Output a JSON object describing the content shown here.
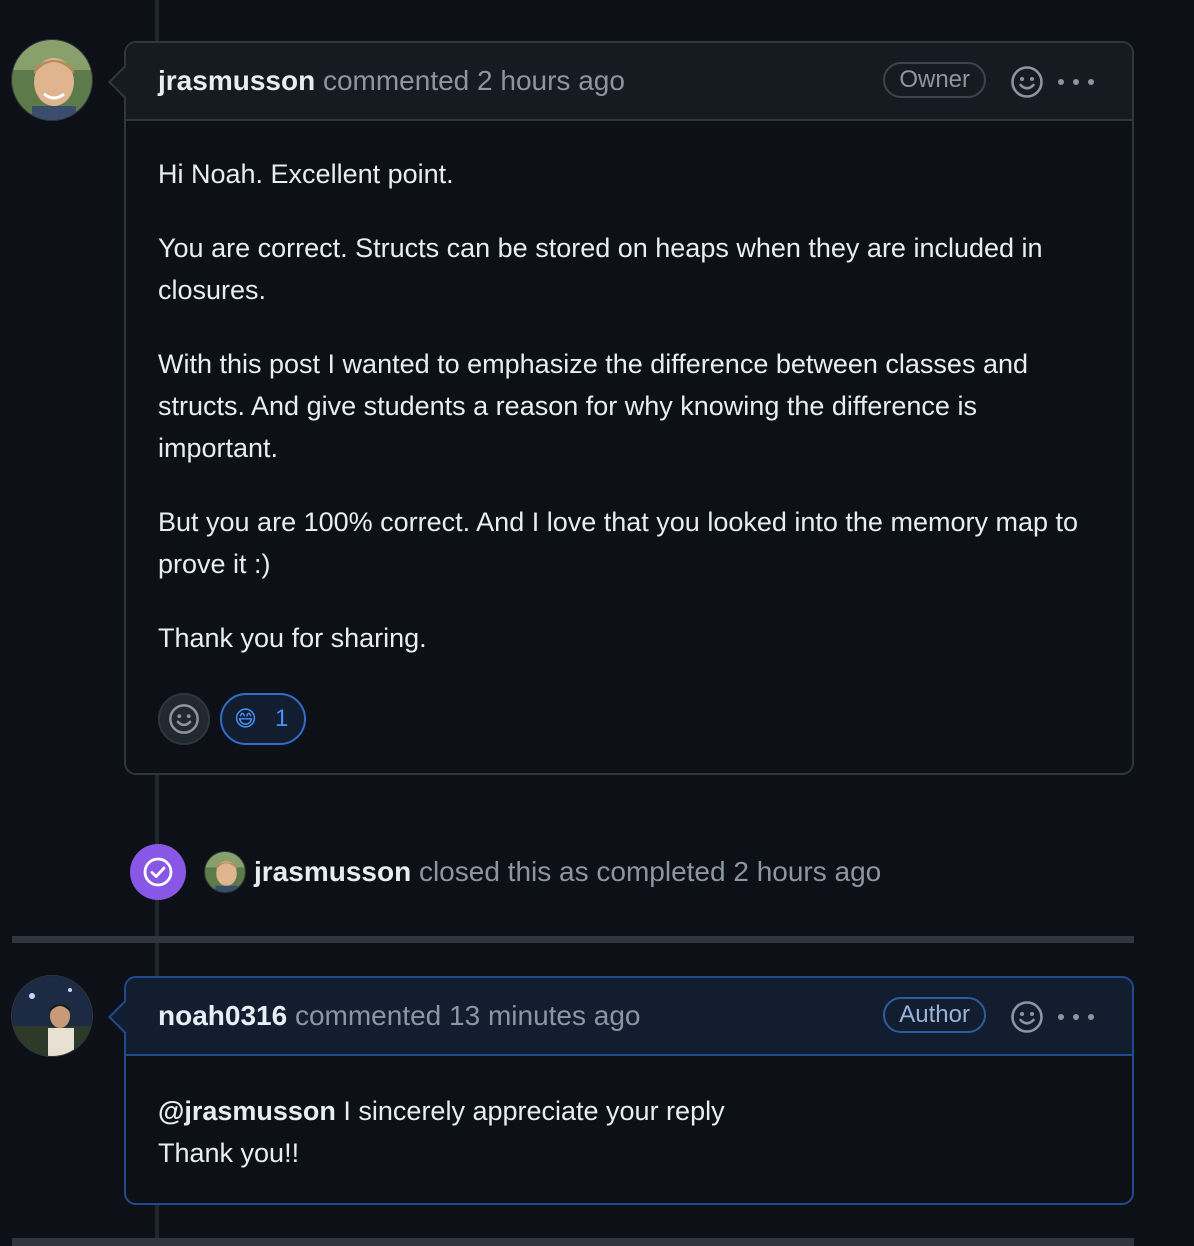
{
  "comment1": {
    "author": "jrasmusson",
    "action": "commented",
    "time": "2 hours ago",
    "badge": "Owner",
    "paragraphs": [
      "Hi Noah. Excellent point.",
      "You are correct. Structs can be stored on heaps when they are included in closures.",
      "With this post I wanted to emphasize the difference between classes and structs. And give students a reason for why knowing the difference is important.",
      "But you are 100% correct. And I love that you looked into the memory map to prove it :)",
      "Thank you for sharing."
    ],
    "reaction": {
      "emoji": "😄",
      "count": "1"
    }
  },
  "event": {
    "user": "jrasmusson",
    "text": "closed this as completed",
    "time": "2 hours ago"
  },
  "comment2": {
    "author": "noah0316",
    "action": "commented",
    "time": "13 minutes ago",
    "badge": "Author",
    "mention": "@jrasmusson",
    "line1": "I sincerely appreciate your reply",
    "line2": "Thank you!!"
  },
  "colors": {
    "background": "#0d1117",
    "closed_badge": "#8957e5",
    "reaction_accent": "#4493f8",
    "author_border": "#1f4b8e"
  }
}
